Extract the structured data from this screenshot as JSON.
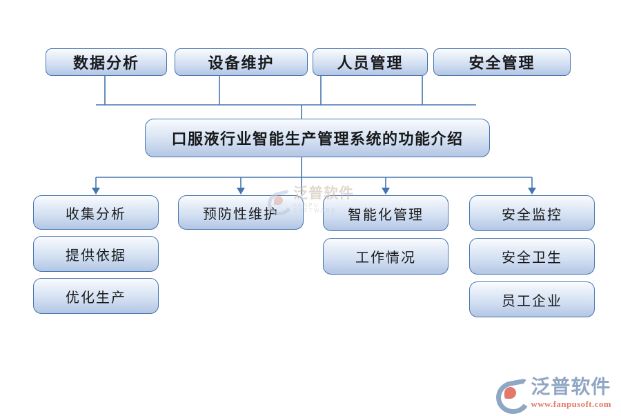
{
  "diagram": {
    "type": "hierarchy-flowchart",
    "background_color": "#ffffff",
    "node_fill_top": "#fbfcfe",
    "node_fill_bottom": "#b3c6e4",
    "node_border_color": "#4575b0",
    "connector_color": "#4575b0",
    "center": {
      "label": "口服液行业智能生产管理系统的功能介绍"
    },
    "top_row": [
      {
        "label": "数据分析"
      },
      {
        "label": "设备维护"
      },
      {
        "label": "人员管理"
      },
      {
        "label": "安全管理"
      }
    ],
    "branches": [
      {
        "parent": "数据分析",
        "items": [
          {
            "label": "收集分析"
          },
          {
            "label": "提供依据"
          },
          {
            "label": "优化生产"
          }
        ]
      },
      {
        "parent": "设备维护",
        "items": [
          {
            "label": "预防性维护"
          }
        ]
      },
      {
        "parent": "人员管理",
        "items": [
          {
            "label": "智能化管理"
          },
          {
            "label": "工作情况"
          }
        ]
      },
      {
        "parent": "安全管理",
        "items": [
          {
            "label": "安全监控"
          },
          {
            "label": "安全卫生"
          },
          {
            "label": "员工企业"
          }
        ]
      }
    ]
  },
  "watermark": {
    "brand_cn": "泛普软件",
    "brand_en": "FANPU SOFTWARE"
  },
  "logo": {
    "brand_cn": "泛普软件",
    "url": "www.fanpusoft.com"
  }
}
